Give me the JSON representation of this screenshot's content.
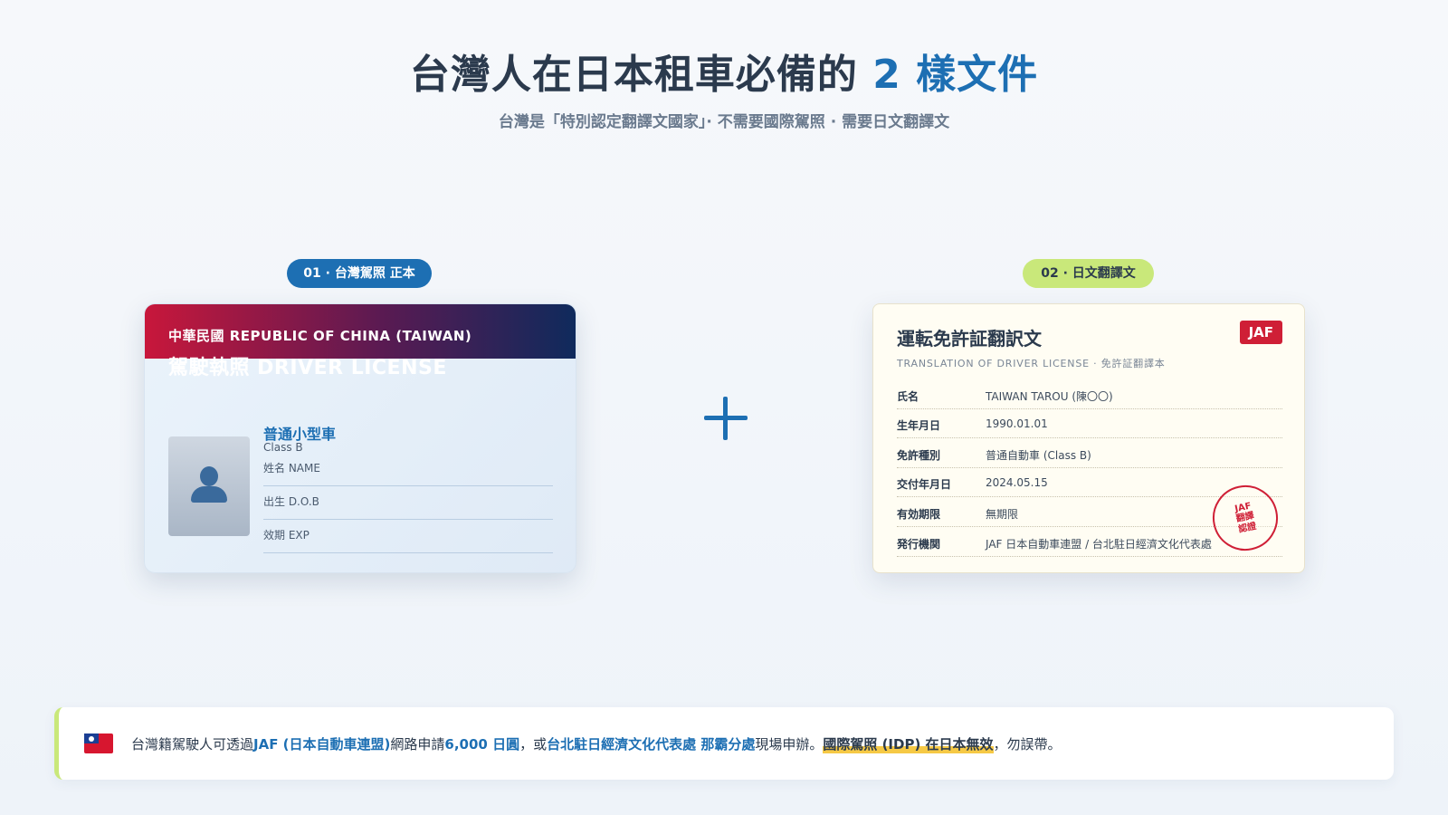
{
  "header": {
    "title_main": "台灣人在日本租車必備的 ",
    "title_accent": "2 樣文件",
    "subtitle": "台灣是「特別認定翻譯文國家」· 不需要國際駕照 · 需要日文翻譯文"
  },
  "doc1": {
    "pill": "01 · 台灣駕照 正本",
    "country": "中華民國 REPUBLIC OF CHINA (TAIWAN)",
    "type": "駕駛執照 DRIVER LICENSE",
    "class_zh": "普通小型車",
    "class_en": "Class B",
    "fields": [
      "姓名 NAME",
      "出生 D.O.B",
      "效期 EXP"
    ]
  },
  "plus_icon": "plus-icon",
  "doc2": {
    "pill": "02 · 日文翻譯文",
    "title": "運転免許証翻訳文",
    "subtitle": "TRANSLATION OF DRIVER LICENSE · 免許証翻譯本",
    "badge": "JAF",
    "rows": [
      {
        "k": "氏名",
        "v": "TAIWAN TAROU (陳〇〇)"
      },
      {
        "k": "生年月日",
        "v": "1990.01.01"
      },
      {
        "k": "免許種別",
        "v": "普通自動車 (Class B)"
      },
      {
        "k": "交付年月日",
        "v": "2024.05.15"
      },
      {
        "k": "有効期限",
        "v": "無期限"
      },
      {
        "k": "発行機関",
        "v": "JAF 日本自動車連盟 / 台北駐日經濟文化代表處"
      }
    ],
    "stamp": [
      "JAF",
      "翻譯",
      "認證"
    ]
  },
  "notice": {
    "t1": "台灣籍駕駛人可透過 ",
    "jaf": "JAF (日本自動車連盟)",
    "t2": " 網路申請 ",
    "price": "6,000 日圓",
    "t3": "，或 ",
    "office": "台北駐日經濟文化代表處 那霸分處",
    "t4": " 現場申辦。 ",
    "warn": "國際駕照 (IDP) 在日本無效",
    "t5": "，勿誤帶。"
  },
  "colors": {
    "accent": "#1d6fb3",
    "lime": "#c9e87a",
    "red": "#cf1f36"
  }
}
